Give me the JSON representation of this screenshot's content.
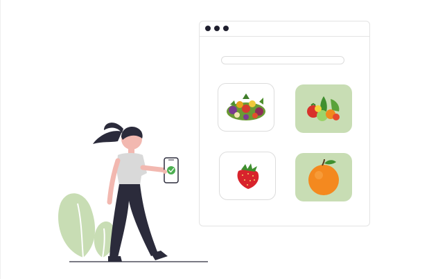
{
  "browser": {
    "window_dots": [
      "window-dot",
      "window-dot",
      "window-dot"
    ],
    "search": {
      "value": "",
      "placeholder": ""
    }
  },
  "products": [
    {
      "name": "mixed-vegetables",
      "icon": "vegetables-pile-icon",
      "style": "outline"
    },
    {
      "name": "fresh-produce",
      "icon": "fruits-vegetables-icon",
      "style": "filled"
    },
    {
      "name": "strawberry",
      "icon": "strawberry-icon",
      "style": "outline"
    },
    {
      "name": "orange",
      "icon": "orange-icon",
      "style": "filled"
    }
  ],
  "phone": {
    "status_icon": "check-circle-icon"
  },
  "colors": {
    "accent_green": "#c8ddb4",
    "check_green": "#4caf50",
    "ink": "#2b2b3b",
    "skin": "#f2b8b0"
  }
}
